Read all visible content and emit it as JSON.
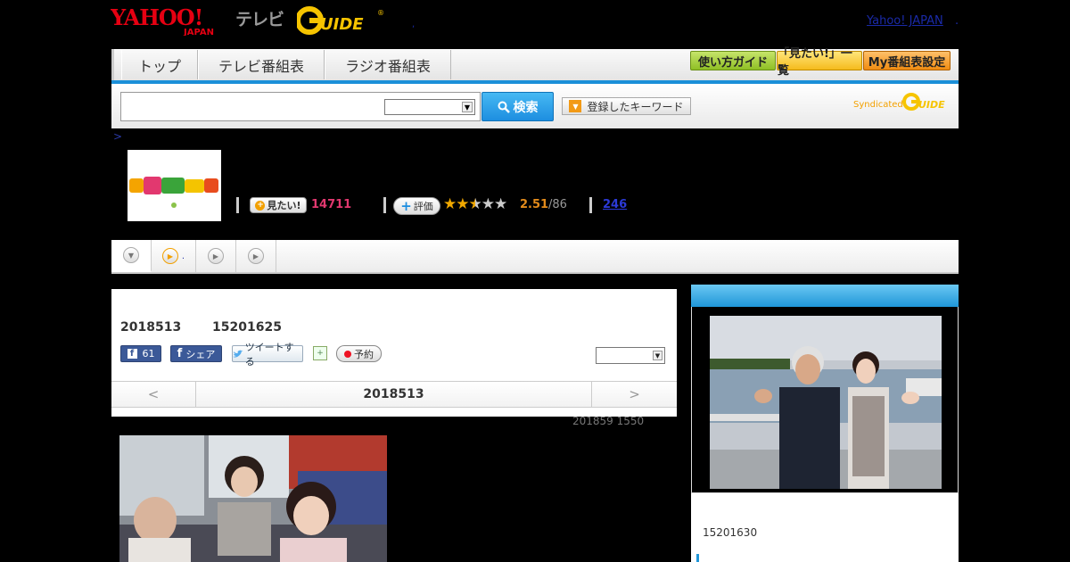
{
  "header": {
    "brand_tv": "テレビ",
    "yahoo_japan_link": "Yahoo! JAPAN",
    "dot": ".",
    "comma": ","
  },
  "nav": {
    "tabs": [
      "トップ",
      "テレビ番組表",
      "ラジオ番組表"
    ],
    "buttons": [
      "使い方ガイド",
      "「見たい!」一覧",
      "My番組表設定"
    ]
  },
  "search": {
    "input_value": "",
    "select_value": "",
    "button_label": "検索",
    "keyword_button": "登録したキーワード",
    "syndicated": "Syndicated"
  },
  "breadcrumb": ">",
  "program": {
    "miru_label": "見たい!",
    "miru_count": "14711",
    "hyoka_label": "評価",
    "rating": "2.51",
    "rating_of": "/86",
    "rating_value": 2.51,
    "rating_max": 5,
    "comments_link": "246"
  },
  "subtabs": {
    "tab2_text": "."
  },
  "main": {
    "date": "2018513",
    "time": "15201625",
    "fb_count": "61",
    "fb_share": "シェア",
    "tweet": "ツイートする",
    "reserve": "予約",
    "select_value": "",
    "prev": "<",
    "next": ">",
    "nav_date": "2018513",
    "updated": "201859  1550"
  },
  "sidebar": {
    "time": "15201630"
  },
  "colors": {
    "accent_blue": "#1a8fd8",
    "miru_pink": "#e2386f",
    "rating_orange": "#e38b1b",
    "gguide_yellow": "#f3a000"
  }
}
